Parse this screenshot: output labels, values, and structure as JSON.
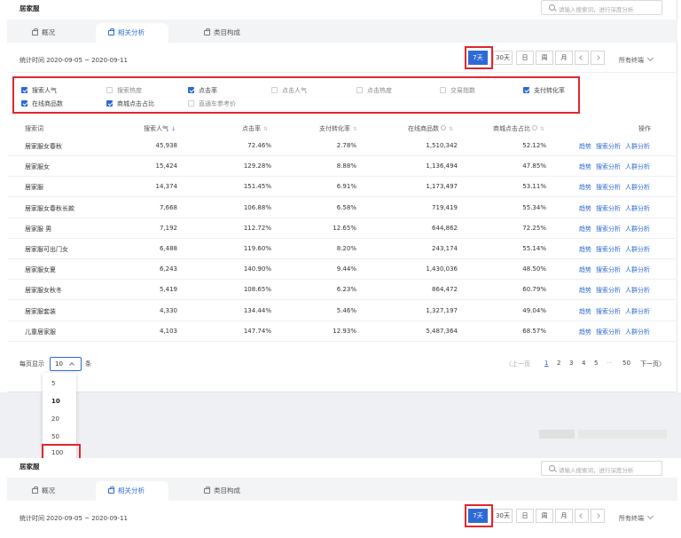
{
  "header": {
    "title": "居家服",
    "search_placeholder": "请输入搜索词，进行深度分析"
  },
  "tabs": [
    {
      "label": "概况"
    },
    {
      "label": "相关分析"
    },
    {
      "label": "类目构成"
    }
  ],
  "date": {
    "range": "统计时间 2020-09-05 ~ 2020-09-11",
    "periods": [
      "7天",
      "30天",
      "日",
      "周",
      "月"
    ],
    "terminal": "所有终端"
  },
  "filters": {
    "row1": [
      {
        "label": "搜索人气",
        "checked": true
      },
      {
        "label": "搜索热度",
        "checked": false
      },
      {
        "label": "点击率",
        "checked": true
      },
      {
        "label": "点击人气",
        "checked": false
      },
      {
        "label": "点击热度",
        "checked": false
      },
      {
        "label": "交易指数",
        "checked": false
      },
      {
        "label": "支付转化率",
        "checked": true
      }
    ],
    "row2": [
      {
        "label": "在线商品数",
        "checked": true
      },
      {
        "label": "商城点击占比",
        "checked": true
      },
      {
        "label": "直通车参考价",
        "checked": false
      }
    ]
  },
  "table": {
    "columns": [
      "搜索词",
      "搜索人气",
      "点击率",
      "支付转化率",
      "在线商品数",
      "商城点击占比",
      "操作"
    ],
    "actions": [
      "趋势",
      "搜索分析",
      "人群分析"
    ],
    "rows": [
      [
        "居家服女春秋",
        "45,938",
        "72.46%",
        "2.78%",
        "1,510,342",
        "52.12%"
      ],
      [
        "居家服女",
        "15,424",
        "129.28%",
        "8.88%",
        "1,136,494",
        "47.85%"
      ],
      [
        "居家服",
        "14,374",
        "151.45%",
        "6.91%",
        "1,173,497",
        "53.11%"
      ],
      [
        "居家服女春秋长款",
        "7,668",
        "106.88%",
        "6.58%",
        "719,419",
        "55.34%"
      ],
      [
        "居家服 男",
        "7,192",
        "112.72%",
        "12.65%",
        "644,862",
        "72.25%"
      ],
      [
        "居家服可出门女",
        "6,488",
        "119.60%",
        "8.20%",
        "243,174",
        "55.14%"
      ],
      [
        "居家服女夏",
        "6,243",
        "140.90%",
        "9.44%",
        "1,430,036",
        "48.50%"
      ],
      [
        "居家服女秋冬",
        "5,419",
        "108.65%",
        "6.23%",
        "864,472",
        "60.79%"
      ],
      [
        "居家服套装",
        "4,330",
        "134.44%",
        "5.46%",
        "1,327,197",
        "49.04%"
      ],
      [
        "儿童居家服",
        "4,103",
        "147.74%",
        "12.93%",
        "5,487,364",
        "68.57%"
      ]
    ]
  },
  "pagination": {
    "per_page_label": "每页显示",
    "per_page_value": "10",
    "per_page_unit": "条",
    "options": [
      "5",
      "10",
      "20",
      "50",
      "100"
    ],
    "prev": "〈上一页",
    "pages": [
      "1",
      "2",
      "3",
      "4",
      "5",
      "···",
      "50"
    ],
    "next": "下一页〉"
  },
  "colors": {
    "accent": "#2d6ad6",
    "highlight": "#e0262f"
  }
}
